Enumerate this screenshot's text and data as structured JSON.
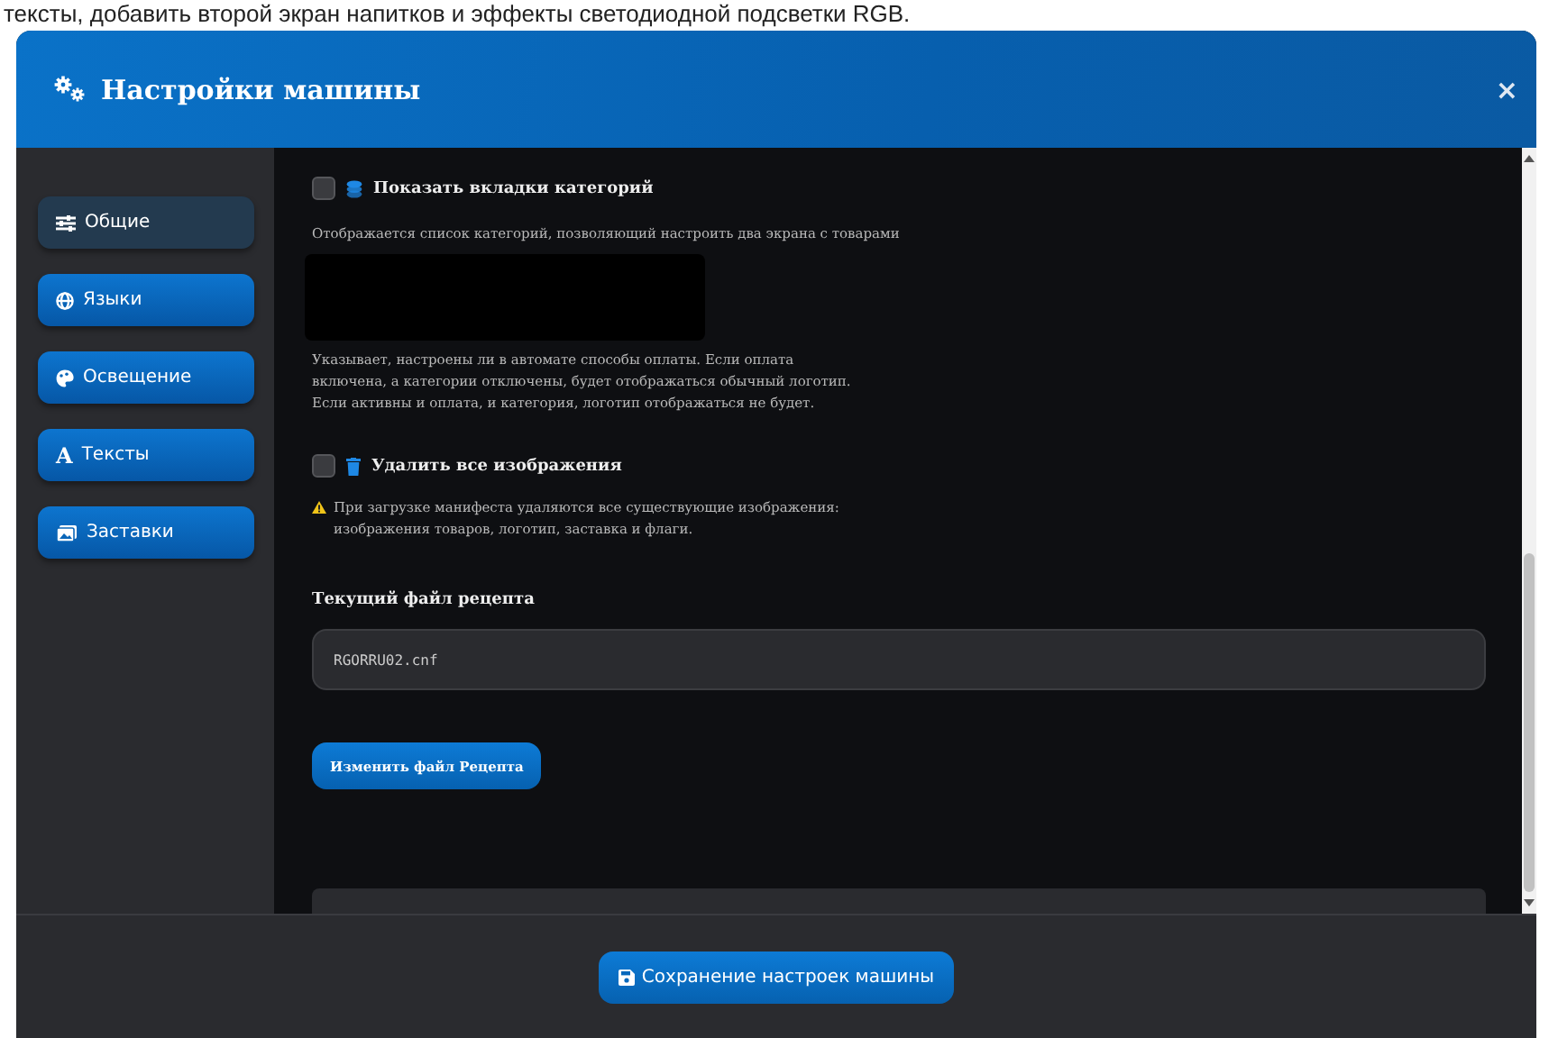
{
  "background_text": "тексты, добавить второй экран напитков и эффекты светодиодной подсветки RGB.",
  "window": {
    "title": "Настройки машины",
    "close": "×"
  },
  "sidebar": {
    "items": [
      {
        "label": "Общие",
        "selected": true
      },
      {
        "label": "Языки",
        "selected": false
      },
      {
        "label": "Освещение",
        "selected": false
      },
      {
        "glyph": "A",
        "label": "Тексты",
        "selected": false
      },
      {
        "label": "Заставки",
        "selected": false
      }
    ]
  },
  "settings": [
    {
      "kind": "checkbox",
      "label": "Показать вкладки категорий",
      "checked": false,
      "description": "Отображается список категорий, позволяющий настроить два экрана с товарами"
    },
    {
      "kind": "redacted"
    },
    {
      "kind": "note",
      "description": "Указывает, настроены ли в автомате способы оплаты. Если оплата включена, а категории отключены, будет отображаться обычный логотип. Если активны и оплата, и категория, логотип отображаться не будет."
    },
    {
      "kind": "checkbox",
      "label": "Удалить все изображения",
      "checked": false,
      "warning": "При загрузке манифеста удаляются все существующие изображения: изображения товаров, логотип, заставка и флаги."
    },
    {
      "kind": "file",
      "label": "Текущий файл рецепта",
      "value": "RGORRU02.cnf",
      "button": "Изменить файл Рецепта"
    }
  ],
  "footer": {
    "button": "Сохранение настроек машины"
  }
}
